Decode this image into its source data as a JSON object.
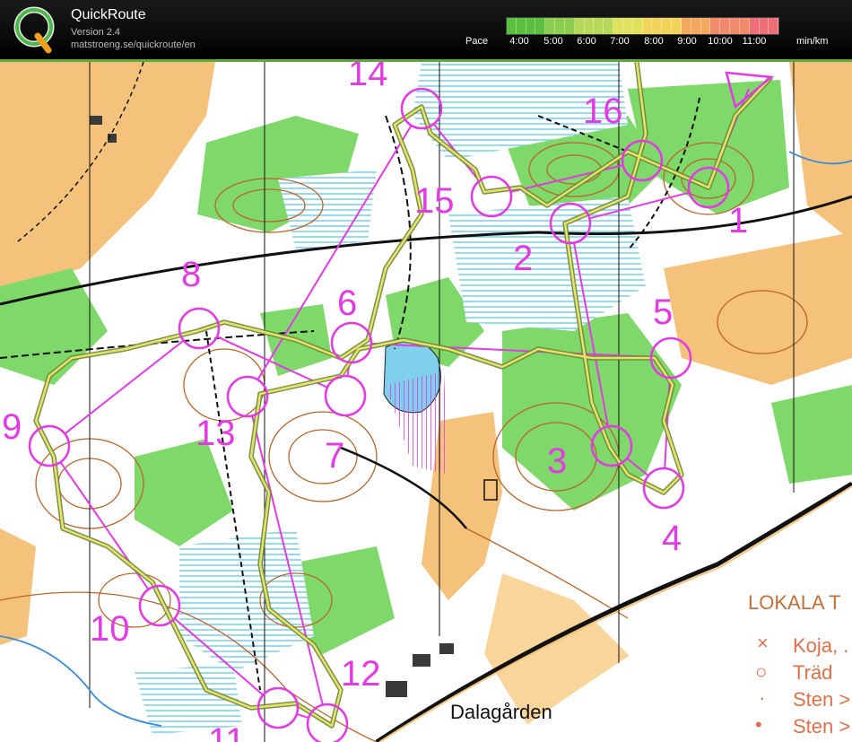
{
  "app": {
    "name": "QuickRoute",
    "version": "Version 2.4",
    "url": "matstroeng.se/quickroute/en"
  },
  "pace_scale": {
    "label": "Pace",
    "unit": "min/km",
    "ticks": [
      "4:00",
      "5:00",
      "6:00",
      "7:00",
      "8:00",
      "9:00",
      "10:00",
      "11:00"
    ],
    "gradient_colors": [
      "#5bbf3e",
      "#8ccc4e",
      "#b8d85a",
      "#e0e25e",
      "#f2d45a",
      "#f4a95e",
      "#f08a6a",
      "#ee6e78"
    ]
  },
  "map": {
    "controls": [
      "1",
      "2",
      "3",
      "4",
      "5",
      "6",
      "7",
      "8",
      "9",
      "10",
      "11",
      "12",
      "13",
      "14",
      "15",
      "16"
    ],
    "place_name": "Dalagården",
    "legend": {
      "title": "LOKALA  T",
      "items": [
        {
          "symbol": "×",
          "label": "Koja, ."
        },
        {
          "symbol": "○",
          "label": "Träd"
        },
        {
          "symbol": "·",
          "label": "Sten >"
        },
        {
          "symbol": "•",
          "label": "Sten >"
        }
      ]
    },
    "colors": {
      "course": "#e23be4",
      "forest": "#ffffff",
      "green": "#7fd86a",
      "open": "#f5c27c",
      "water": "#7fd0ec",
      "contour": "#b8642c"
    }
  }
}
